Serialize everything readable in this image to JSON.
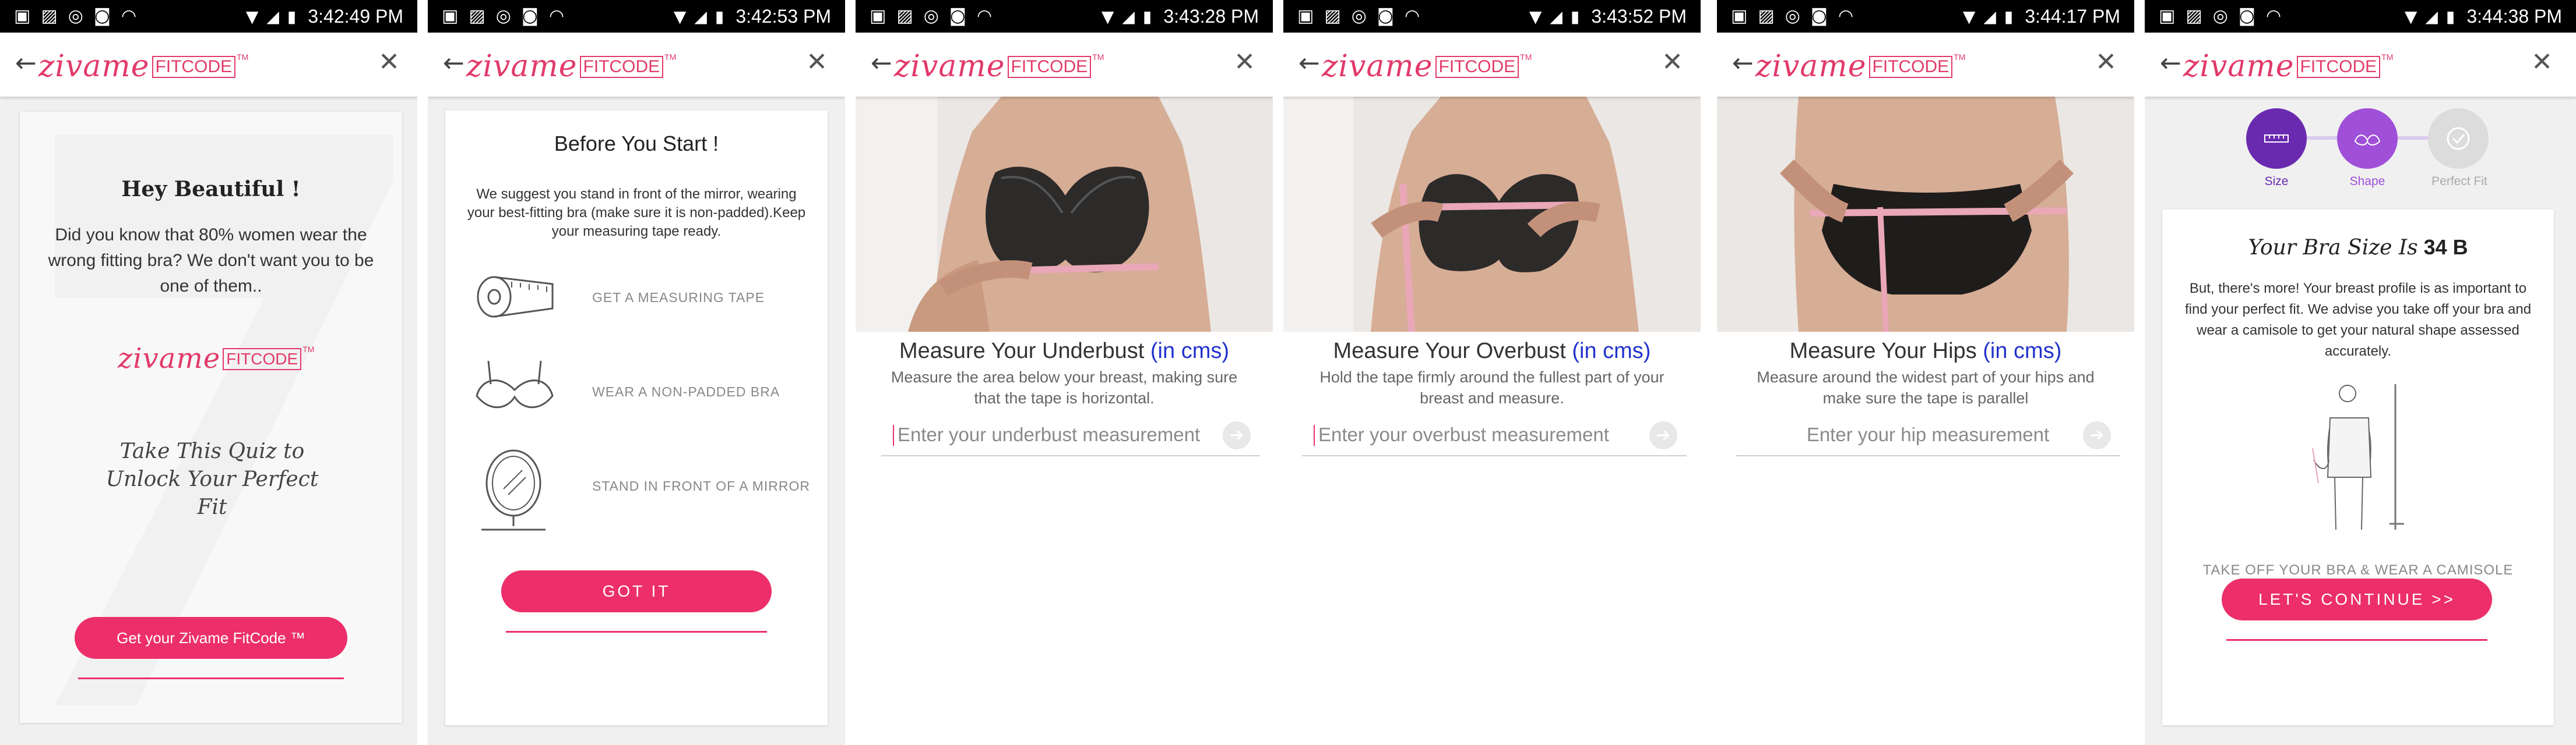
{
  "statusbar": {
    "icons_left": [
      "message-icon",
      "image-icon",
      "whatsapp-icon",
      "camera-icon",
      "wifi-icon"
    ],
    "times": [
      "3:42:49 PM",
      "3:42:53 PM",
      "3:43:28 PM",
      "3:43:52 PM",
      "3:44:17 PM",
      "3:44:38 PM"
    ]
  },
  "brand": {
    "script": "zivame",
    "fit": "FITCODE",
    "tm": "TM",
    "color": "#e23a6a"
  },
  "accent": "#ec2f6a",
  "screens": {
    "s1": {
      "title": "Hey Beautiful !",
      "body": "Did you know that 80% women wear the wrong fitting bra? We don't want you to be one of them..",
      "tagline": "Take This Quiz to Unlock Your Perfect Fit",
      "button": "Get your Zivame FitCode ™"
    },
    "s2": {
      "title": "Before You Start !",
      "body": "We suggest you stand in front of the mirror, wearing your best-fitting bra (make sure it is non-padded).Keep your measuring tape ready.",
      "items": [
        "GET A MEASURING TAPE",
        "WEAR A NON-PADDED BRA",
        "STAND IN FRONT OF A MIRROR"
      ],
      "button": "GOT IT"
    },
    "s3": {
      "title": "Measure Your Underbust",
      "unit": "(in cms)",
      "desc": "Measure the area below your breast, making sure that the tape is horizontal.",
      "placeholder": "Enter your underbust measurement"
    },
    "s4": {
      "title": "Measure Your Overbust",
      "unit": "(in cms)",
      "desc": "Hold the tape firmly around the fullest part of your breast and measure.",
      "placeholder": "Enter your overbust measurement"
    },
    "s5": {
      "title": "Measure Your Hips",
      "unit": "(in cms)",
      "desc": "Measure around the widest part of your hips and make sure the tape is parallel",
      "placeholder": "Enter your hip measurement"
    },
    "s6": {
      "steps": [
        "Size",
        "Shape",
        "Perfect Fit"
      ],
      "result_label": "Your Bra Size Is",
      "result_value": "34 B",
      "body": "But, there's more! Your breast profile is as important to find your perfect fit. We advise you take off your bra and wear a camisole to get your natural shape assessed accurately.",
      "caption": "TAKE OFF YOUR BRA & WEAR A CAMISOLE",
      "button": "LET'S CONTINUE >>"
    }
  }
}
